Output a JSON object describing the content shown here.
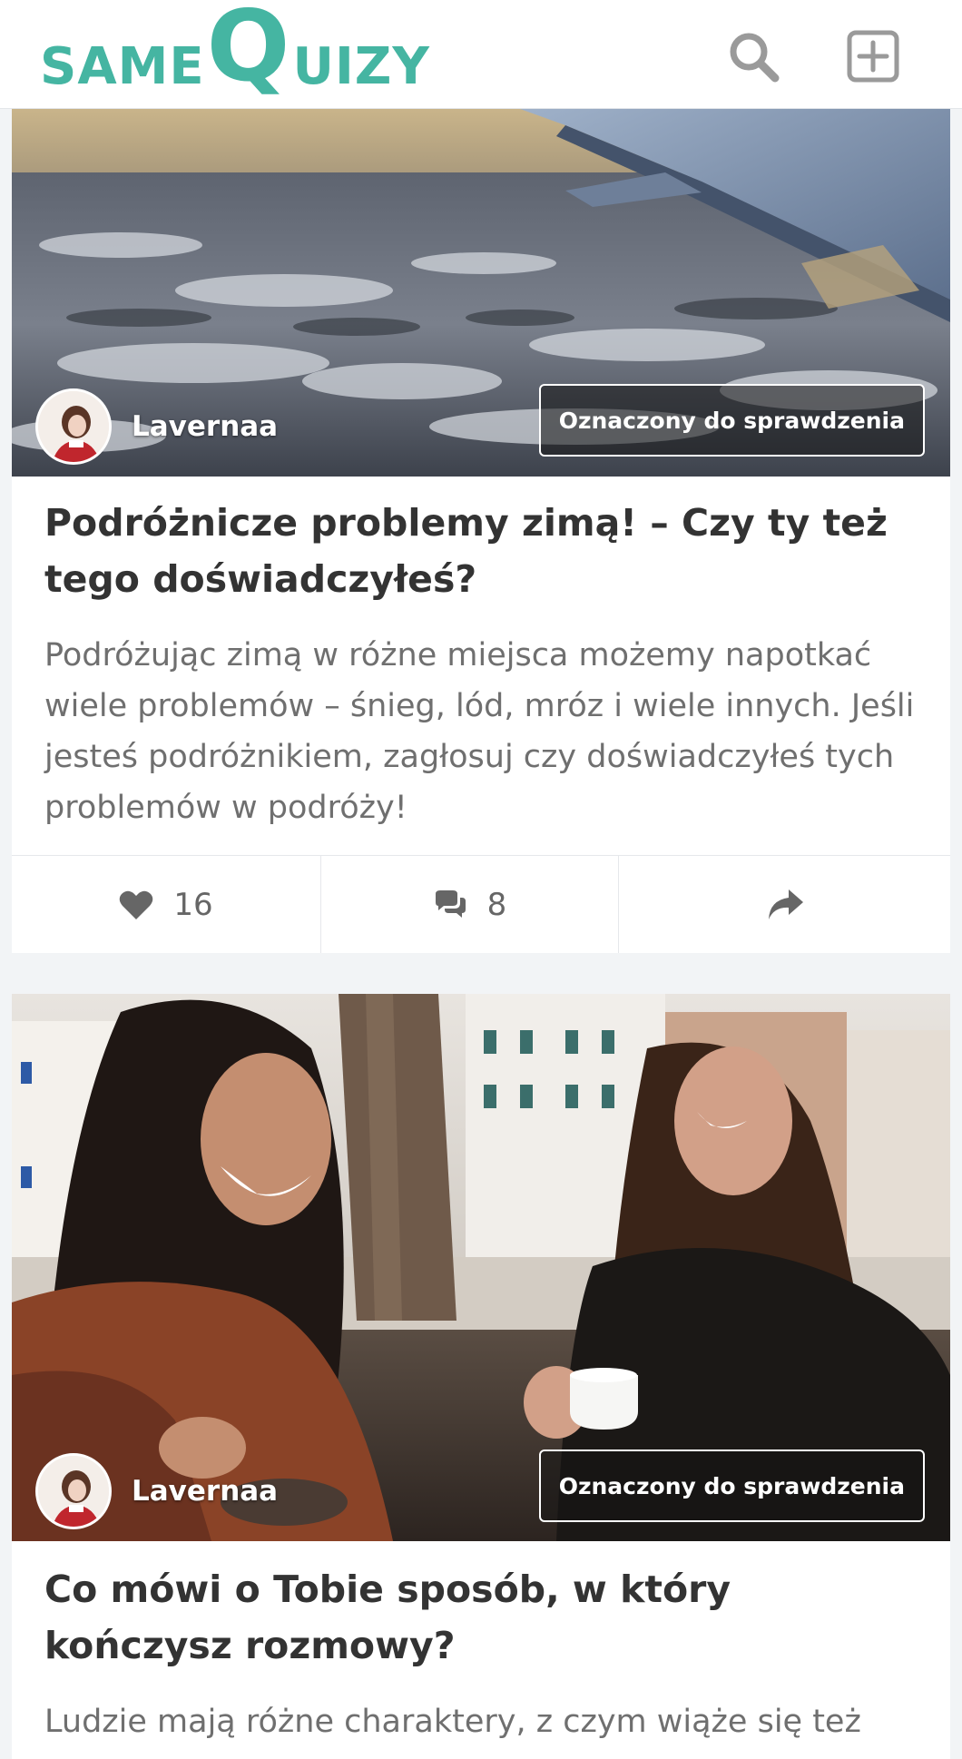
{
  "header": {
    "logo_part1": "SAME",
    "logo_part2": "Q",
    "logo_part3": "UIZY",
    "logo_color": "#45b5a2",
    "icons": [
      "search-icon",
      "add-square-icon"
    ]
  },
  "posts": [
    {
      "author": "Lavernaa",
      "badge": "Oznaczony do sprawdzenia",
      "title": "Podróżnicze problemy zimą! – Czy ty też tego doświadczyłeś?",
      "description": "Podróżując zimą w różne miejsca możemy napotkać wiele problemów – śnieg, lód, mróz i wiele innych. Jeśli jesteś podróżnikiem, zagłosuj czy doświadczyłeś tych problemów w podróży!",
      "likes": "16",
      "comments": "8",
      "image": "airplane-wing-over-snowy-town"
    },
    {
      "author": "Lavernaa",
      "badge": "Oznaczony do sprawdzenia",
      "title": "Co mówi o Tobie sposób, w który kończysz rozmowy?",
      "description": "Ludzie mają różne charaktery, z czym wiąże się też",
      "image": "two-women-laughing-with-coffee"
    }
  ]
}
